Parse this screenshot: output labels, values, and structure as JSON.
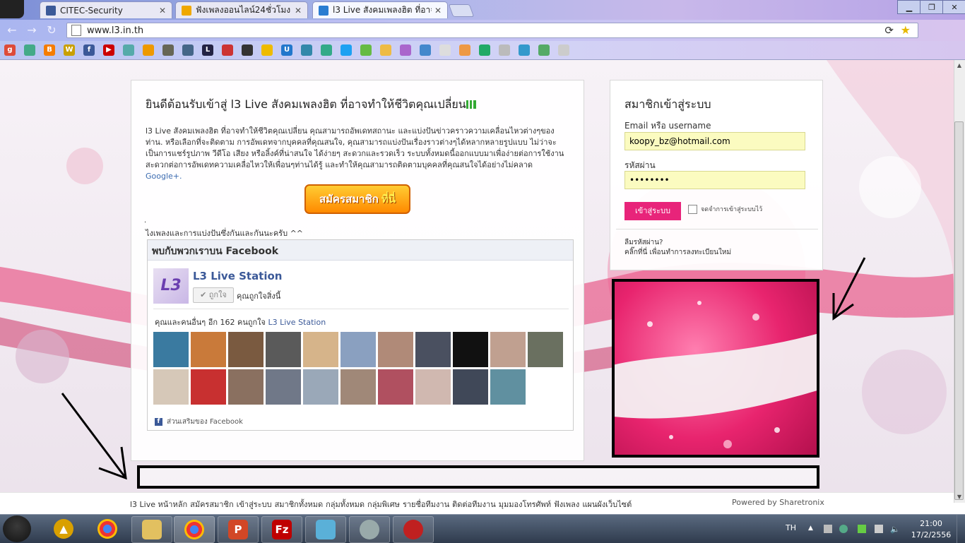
{
  "browser": {
    "tabs": [
      {
        "label": "CITEC-Security",
        "favicon_color": "#3b5998",
        "active": false
      },
      {
        "label": "ฟังเพลงออนไลน์24ชั่วโมง แข",
        "favicon_color": "#f0a800",
        "active": false
      },
      {
        "label": "l3 Live สังคมเพลงฮิต ที่อาจทำ",
        "favicon_color": "#2a7dd1",
        "active": true
      }
    ],
    "url": "www.l3.in.th"
  },
  "welcome": {
    "title": "ยินดีต้อนรับเข้าสู่ l3 Live สังคมเพลงฮิต ที่อาจทำให้ชีวิตคุณเปลี่ยน",
    "intro": "l3 Live สังคมเพลงฮิต ที่อาจทำให้ชีวิตคุณเปลี่ยน คุณสามารถอัพเดทสถานะ และแบ่งปันข่าวคราวความเคลื่อนไหวต่างๆของท่าน. หรือเลือกที่จะติดตาม การอัพเดทจากบุคคลที่คุณสนใจ, คุณสามารถแบ่งปันเรื่องราวต่างๆได้หลากหลายรูปแบบ ไม่ว่าจะเป็นการแชร์รูปภาพ วีดีโอ เสียง หรือลิ้งค์ที่น่าสนใจ ได้ง่ายๆ สะดวกและรวดเร็ว ระบบทั้งหมดนี้ออกแบบมาเพื่อง่ายต่อการใช้งาน สะดวกต่อการอัพเดทความเคลื่อไหวให้เพื่อนๆท่านได้รู้ และทำให้คุณสามารถติดตามบุคคลที่คุณสนใจได้อย่างไม่คลาด",
    "intro_link": "Google+.",
    "signup_main": "สมัครสมาชิก",
    "signup_highlight": "ที่นี่",
    "dot": ".",
    "tagline": "ไงเพลงและการแบ่งปันซึ่งกันและกันนะครับ ^^"
  },
  "facebook": {
    "header": "พบกับพวกเราบน Facebook",
    "logo_text": "L3",
    "page_name": "L3 Live Station",
    "like_button": "✔ ถูกใจ",
    "like_text": "คุณถูกใจสิ่งนี้",
    "count_text": "คุณและคนอื่นๆ อีก 162 คนถูกใจ",
    "count_link": "L3 Live Station",
    "plugin_text": "ส่วนเสริมของ Facebook",
    "face_colors": [
      "#3a7aa0",
      "#c97a3a",
      "#7a5a40",
      "#5a5a5a",
      "#d6b48a",
      "#8aa0c0",
      "#b08a78",
      "#4a5060",
      "#111111",
      "#c0a090",
      "#6a7060",
      "#d6c8b8",
      "#c83030",
      "#8a7060",
      "#707888",
      "#9aa8b8",
      "#a08878",
      "#b05060",
      "#d0b8b0",
      "#404858",
      "#6090a0"
    ]
  },
  "login": {
    "title": "สมาชิกเข้าสู่ระบบ",
    "email_label": "Email หรือ username",
    "email_value": "koopy_bz@hotmail.com",
    "password_label": "รหัสผ่าน",
    "password_value": "••••••••",
    "login_button": "เข้าสู่ระบบ",
    "remember_label": "จดจำการเข้าสู่ระบบไว้",
    "forgot_question": "ลืมรหัสผ่าน?",
    "forgot_link": "คลิ๊กที่นี่ เพื่อนทำการลงทะเบียนใหม่"
  },
  "footer": {
    "links": [
      "l3 Live หน้าหลัก",
      "สมัครสมาชิก",
      "เข้าสู่ระบบ",
      "สมาชิกทั้งหมด",
      "กลุ่มทั้งหมด",
      "กลุ่มพิเศษ",
      "รายชื่อทีมงาน",
      "ติดต่อทีมงาน",
      "มุมมองโทรศัพท์",
      "ฟังเพลง",
      "แผนผังเว็บไซต์"
    ],
    "powered": "Powered by Sharetronix"
  },
  "taskbar": {
    "language": "TH",
    "time": "21:00",
    "date": "17/2/2556"
  }
}
